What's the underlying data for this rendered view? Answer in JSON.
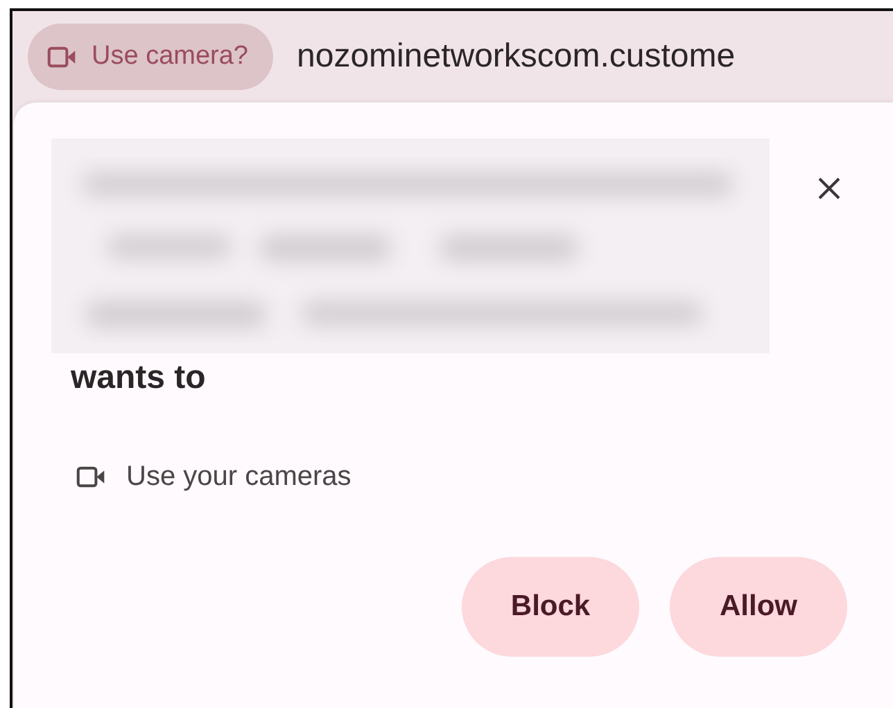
{
  "address_bar": {
    "permission_chip": "Use camera?",
    "url": "nozominetworkscom.custome"
  },
  "dialog": {
    "redacted": true,
    "heading": "wants to",
    "permissions": [
      {
        "kind": "camera",
        "label": "Use your cameras"
      }
    ],
    "buttons": [
      "Block",
      "Allow"
    ]
  }
}
